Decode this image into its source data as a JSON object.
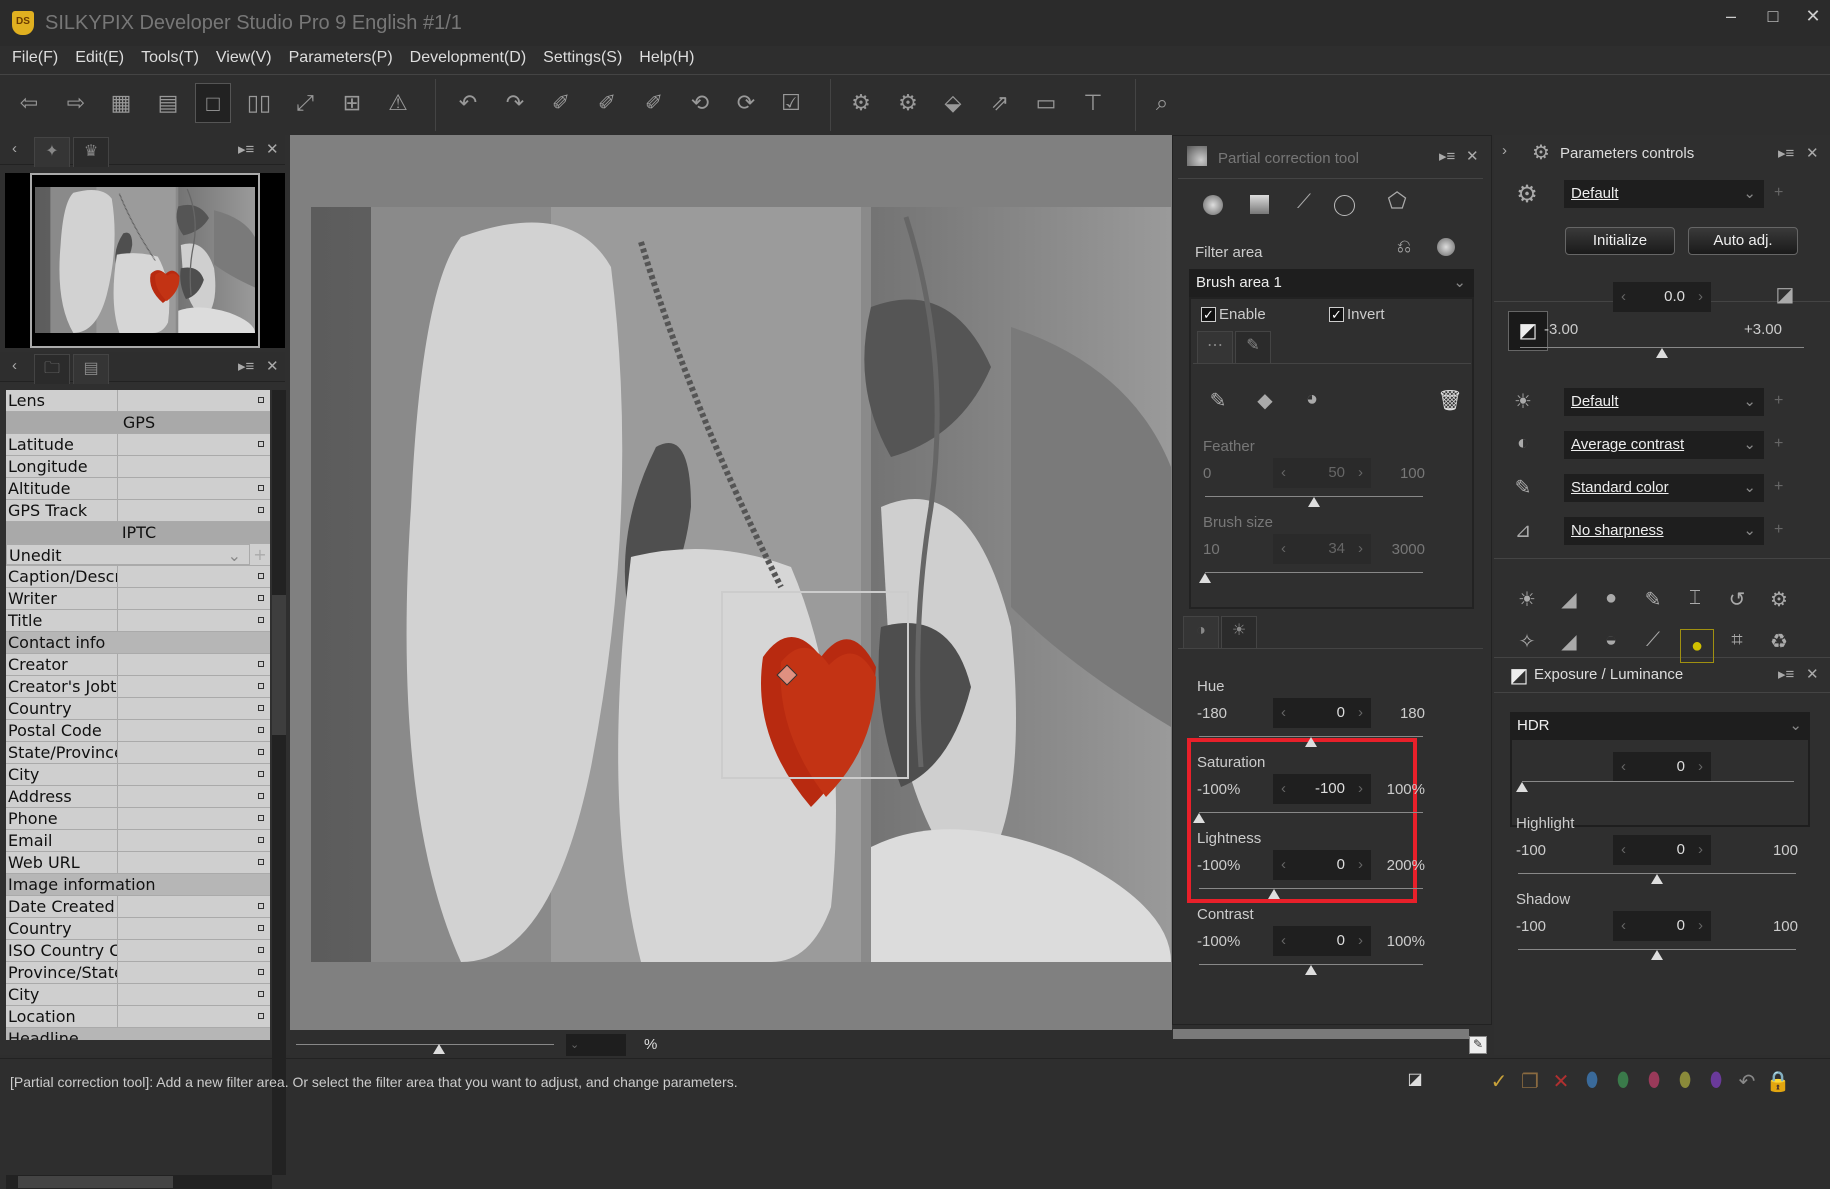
{
  "window": {
    "title": "SILKYPIX Developer Studio Pro 9 English   #1/1",
    "logo": "DS"
  },
  "menu": [
    "File(F)",
    "Edit(E)",
    "Tools(T)",
    "View(V)",
    "Parameters(P)",
    "Development(D)",
    "Settings(S)",
    "Help(H)"
  ],
  "toolbar": [
    "back-icon",
    "forward-icon",
    "grid-view-icon",
    "filmstrip-view-icon",
    "single-view-icon",
    "compare-view-icon",
    "fullscreen-icon",
    "fit-icon",
    "warning-icon",
    "undo-icon",
    "redo-icon",
    "white-balance-picker-icon",
    "gray-picker-icon",
    "black-picker-icon",
    "rotate-left-icon",
    "rotate-right-icon",
    "mark-check-icon",
    "save-settings-icon",
    "apply-settings-icon",
    "develop-icon",
    "export-icon",
    "screen-icon",
    "tools-icon",
    "loupe-icon"
  ],
  "metadata": {
    "rows": [
      {
        "type": "row",
        "label": "Lens",
        "mark": true
      },
      {
        "type": "section",
        "label": "GPS"
      },
      {
        "type": "row",
        "label": "Latitude",
        "mark": true
      },
      {
        "type": "row",
        "label": "Longitude",
        "mark": false
      },
      {
        "type": "row",
        "label": "Altitude",
        "mark": true
      },
      {
        "type": "row",
        "label": "GPS Track",
        "mark": true
      },
      {
        "type": "section",
        "label": "IPTC"
      },
      {
        "type": "select",
        "label": "Unedit"
      },
      {
        "type": "row",
        "label": "Caption/Descr",
        "mark": true
      },
      {
        "type": "row",
        "label": "Writer",
        "mark": true
      },
      {
        "type": "row",
        "label": "Title",
        "mark": true
      },
      {
        "type": "group",
        "label": "Contact info"
      },
      {
        "type": "row",
        "label": "Creator",
        "mark": true
      },
      {
        "type": "row",
        "label": "Creator's Jobti",
        "mark": true
      },
      {
        "type": "row",
        "label": "Country",
        "mark": true
      },
      {
        "type": "row",
        "label": "Postal Code",
        "mark": true
      },
      {
        "type": "row",
        "label": "State/Province",
        "mark": true
      },
      {
        "type": "row",
        "label": "City",
        "mark": true
      },
      {
        "type": "row",
        "label": "Address",
        "mark": true
      },
      {
        "type": "row",
        "label": "Phone",
        "mark": true
      },
      {
        "type": "row",
        "label": "Email",
        "mark": true
      },
      {
        "type": "row",
        "label": "Web URL",
        "mark": true
      },
      {
        "type": "group",
        "label": "Image information"
      },
      {
        "type": "row",
        "label": "Date Created",
        "mark": true
      },
      {
        "type": "row",
        "label": "Country",
        "mark": true
      },
      {
        "type": "row",
        "label": "ISO Country C",
        "mark": true
      },
      {
        "type": "row",
        "label": "Province/State",
        "mark": true
      },
      {
        "type": "row",
        "label": "City",
        "mark": true
      },
      {
        "type": "row",
        "label": "Location",
        "mark": true
      },
      {
        "type": "group",
        "label": "Headline"
      }
    ]
  },
  "viewer": {
    "zoom_unit": "%"
  },
  "partial": {
    "title": "Partial correction tool",
    "filter_area_label": "Filter area",
    "filter_area_value": "Brush area 1",
    "enable_label": "Enable",
    "enable_checked": true,
    "invert_label": "Invert",
    "invert_checked": true,
    "feather": {
      "label": "Feather",
      "min": "0",
      "max": "100",
      "value": "50",
      "fraction": 0.5
    },
    "brush_size": {
      "label": "Brush size",
      "min": "10",
      "max": "3000",
      "value": "34",
      "fraction": 0.0
    },
    "hue": {
      "label": "Hue",
      "min": "-180",
      "max": "180",
      "value": "0",
      "fraction": 0.5
    },
    "saturation": {
      "label": "Saturation",
      "min": "-100%",
      "max": "100%",
      "value": "-100",
      "fraction": 0.0
    },
    "lightness": {
      "label": "Lightness",
      "min": "-100%",
      "max": "200%",
      "value": "0",
      "fraction": 0.333
    },
    "contrast": {
      "label": "Contrast",
      "min": "-100%",
      "max": "100%",
      "value": "0",
      "fraction": 0.5
    },
    "highlight_color": "#e8202a"
  },
  "params": {
    "title": "Parameters controls",
    "preset": "Default",
    "initialize": "Initialize",
    "auto_adj": "Auto adj.",
    "exposure": {
      "value": "0.0",
      "min": "-3.00",
      "max": "+3.00",
      "fraction": 0.5
    },
    "tone": "Default",
    "contrast": "Average contrast",
    "color": "Standard color",
    "sharpness": "No sharpness"
  },
  "exposure_panel": {
    "title": "Exposure / Luminance",
    "hdr_label": "HDR",
    "hdr_value": "0",
    "hdr_fraction": 0.0,
    "highlight": {
      "label": "Highlight",
      "min": "-100",
      "max": "100",
      "value": "0",
      "fraction": 0.5
    },
    "shadow": {
      "label": "Shadow",
      "min": "-100",
      "max": "100",
      "value": "0",
      "fraction": 0.5
    }
  },
  "status": {
    "text": "[Partial correction tool]: Add a new filter area. Or select the filter area that you want to adjust, and change parameters."
  }
}
